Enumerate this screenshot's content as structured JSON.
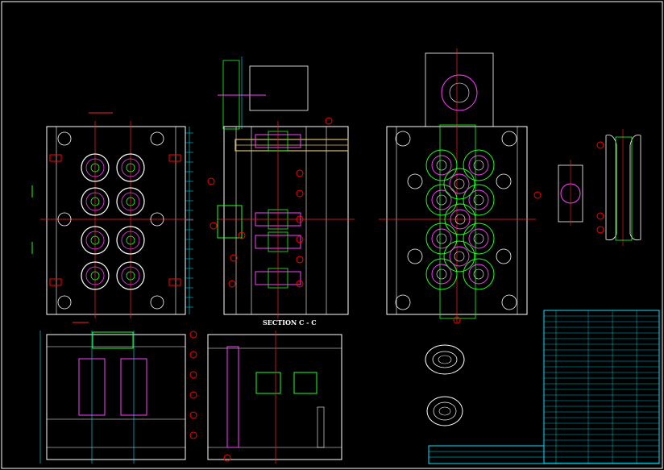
{
  "drawing": {
    "section_label": "SECTION C - C",
    "colors": {
      "background": "#000000",
      "outline": "#ffffff",
      "centerline": "#ff2020",
      "dimension": "#00e5ff",
      "component": "#20ff20",
      "hatch": "#ff40ff",
      "cooling": "#2040ff",
      "balloon": "#ff0000",
      "rail": "#d8c070"
    }
  }
}
